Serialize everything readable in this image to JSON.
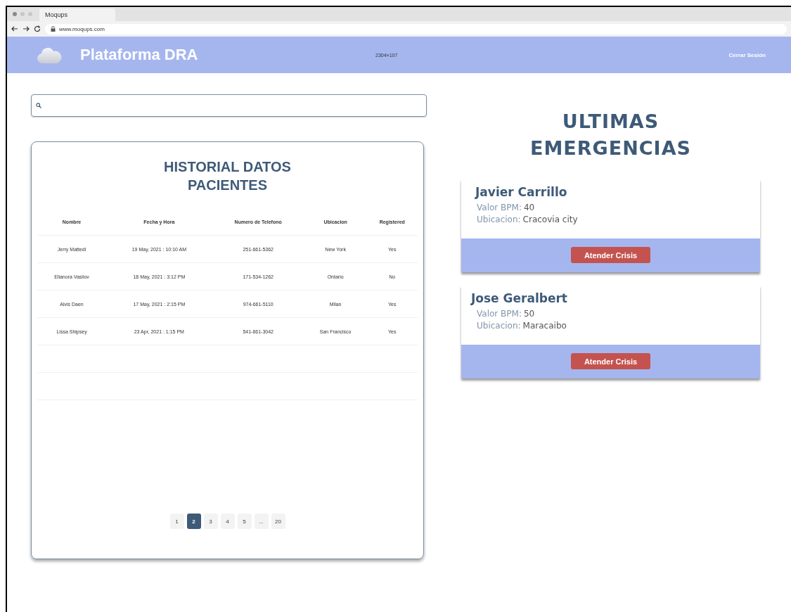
{
  "browser": {
    "tab": "Moqups",
    "url": "www.moqups.com"
  },
  "header": {
    "title": "Plataforma DRA",
    "size_note": "2304×107",
    "logout": "Cerrar Sesión"
  },
  "history": {
    "title": "HISTORIAL DATOS PACIENTES",
    "columns": [
      "Nombre",
      "Fecha y Hora",
      "Numero de Telefono",
      "Ubicacion",
      "Registered"
    ],
    "rows": [
      [
        "Jerry Mattedi",
        "19 May, 2021 : 10:10 AM",
        "251-661-5362",
        "New York",
        "Yes"
      ],
      [
        "Elianora Vasilov",
        "18 May, 2021 : 3:12 PM",
        "171-534-1262",
        "Ontario",
        "No"
      ],
      [
        "Alvis Daen",
        "17 May, 2021 : 2:15 PM",
        "974-661-5110",
        "Milan",
        "Yes"
      ],
      [
        "Lissa Shipsey",
        "23 Apr, 2021 : 1:15 PM",
        "541-661-3042",
        "San Francisco",
        "Yes"
      ]
    ],
    "pages": [
      {
        "label": "1",
        "selected": false
      },
      {
        "label": "2",
        "selected": true
      },
      {
        "label": "3",
        "selected": false
      },
      {
        "label": "4",
        "selected": false
      },
      {
        "label": "5",
        "selected": false
      },
      {
        "label": "...",
        "selected": false
      },
      {
        "label": "20",
        "selected": false
      }
    ]
  },
  "emergencies": {
    "title": "ULTIMAS EMERGENCIAS",
    "cards": [
      {
        "name": "Javier Carrillo",
        "fields": [
          {
            "label": "Valor BPM:",
            "value": "40"
          },
          {
            "label": "Ubicacion:",
            "value": "Cracovia city"
          }
        ],
        "button": "Atender Crisis"
      },
      {
        "name": "Jose Geralbert",
        "fields": [
          {
            "label": "Valor BPM:",
            "value": "50"
          },
          {
            "label": "Ubicacion:",
            "value": "Maracaibo"
          }
        ],
        "button": "Atender Crisis"
      }
    ]
  }
}
